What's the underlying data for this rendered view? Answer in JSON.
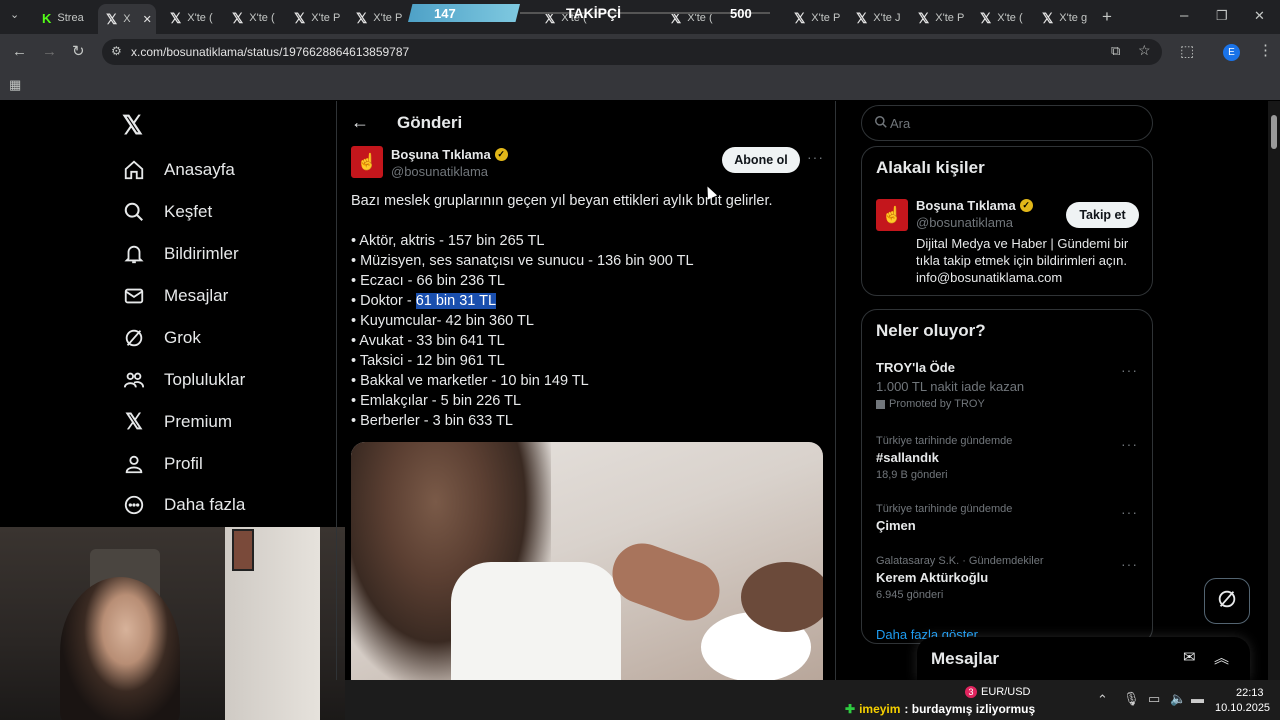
{
  "browser": {
    "tabs": [
      {
        "label": "Strea",
        "icon": "kick-icon"
      },
      {
        "label": "X",
        "icon": "x-logo-icon",
        "active": true
      },
      {
        "label": "X'te ("
      },
      {
        "label": "X'te ("
      },
      {
        "label": "X'te P"
      },
      {
        "label": "X'te P"
      },
      {
        "label": "X'te B"
      },
      {
        "label": "X'te ("
      },
      {
        "label": "X'te ("
      },
      {
        "label": "X'te ("
      },
      {
        "label": "X'te P"
      },
      {
        "label": "X'te J"
      },
      {
        "label": "X'te P"
      },
      {
        "label": "X'te ("
      },
      {
        "label": "X'te g"
      }
    ],
    "url": "x.com/bosunatiklama/status/1976628864613859787",
    "profile_initial": "E"
  },
  "stream_overlay": {
    "count_left": "147",
    "label": "TAKİPÇİ",
    "count_right": "500"
  },
  "nav": {
    "items": [
      {
        "label": "Anasayfa",
        "icon": "home-icon"
      },
      {
        "label": "Keşfet",
        "icon": "search-icon"
      },
      {
        "label": "Bildirimler",
        "icon": "bell-icon"
      },
      {
        "label": "Mesajlar",
        "icon": "mail-icon"
      },
      {
        "label": "Grok",
        "icon": "grok-icon"
      },
      {
        "label": "Topluluklar",
        "icon": "communities-icon"
      },
      {
        "label": "Premium",
        "icon": "x-logo-icon"
      },
      {
        "label": "Profil",
        "icon": "person-icon"
      },
      {
        "label": "Daha fazla",
        "icon": "more-circle-icon"
      }
    ]
  },
  "header": {
    "title": "Gönderi"
  },
  "tweet": {
    "author_name": "Boşuna Tıklama",
    "author_handle": "@bosunatiklama",
    "subscribe_label": "Abone ol",
    "intro": "Bazı meslek gruplarının geçen yıl beyan ettikleri aylık brüt gelirler.",
    "lines": [
      "• Aktör, aktris - 157 bin 265 TL",
      "• Müzisyen, ses sanatçısı ve sunucu - 136 bin 900 TL",
      "• Eczacı - 66 bin 236 TL",
      "• Doktor - ",
      "• Kuyumcular- 42 bin 360 TL",
      "• Avukat - 33 bin 641 TL",
      "• Taksici - 12 bin 961 TL",
      "• Bakkal ve marketler - 10 bin 149 TL",
      "• Emlakçılar - 5 bin 226 TL",
      "• Berberler - 3 bin 633 TL"
    ],
    "highlighted": "61 bin 31 TL"
  },
  "search": {
    "placeholder": "Ara"
  },
  "related": {
    "title": "Alakalı kişiler",
    "name": "Boşuna Tıklama",
    "handle": "@bosunatiklama",
    "follow_label": "Takip et",
    "bio": "Dijital Medya ve Haber | Gündemi bir tıkla takip etmek için bildirimleri açın. info@bosunatiklama.com"
  },
  "trends": {
    "title": "Neler oluyor?",
    "items": [
      {
        "meta": "",
        "title": "TROY'la Öde",
        "sub": "1.000 TL nakit iade kazan",
        "promo": "Promoted by TROY"
      },
      {
        "meta": "Türkiye tarihinde gündemde",
        "title": "#sallandık",
        "sub": "18,9 B gönderi"
      },
      {
        "meta": "Türkiye tarihinde gündemde",
        "title": "Çimen",
        "sub": ""
      },
      {
        "meta": "Galatasaray S.K. · Gündemdekiler",
        "title": "Kerem Aktürkoğlu",
        "sub": "6.945 gönderi"
      }
    ],
    "show_more": "Daha fazla göster"
  },
  "messages_drawer": {
    "title": "Mesajlar"
  },
  "taskbar": {
    "chat_user": "imeyim",
    "chat_text": ": burdaymış izliyormuş",
    "currency": "EUR/USD",
    "badge": "3",
    "time": "22:13",
    "date": "10.10.2025"
  },
  "colors": {
    "accent": "#1d9bf0",
    "highlight": "#1a4fae",
    "verified": "#e2b719",
    "brand_red": "#c4161c"
  }
}
